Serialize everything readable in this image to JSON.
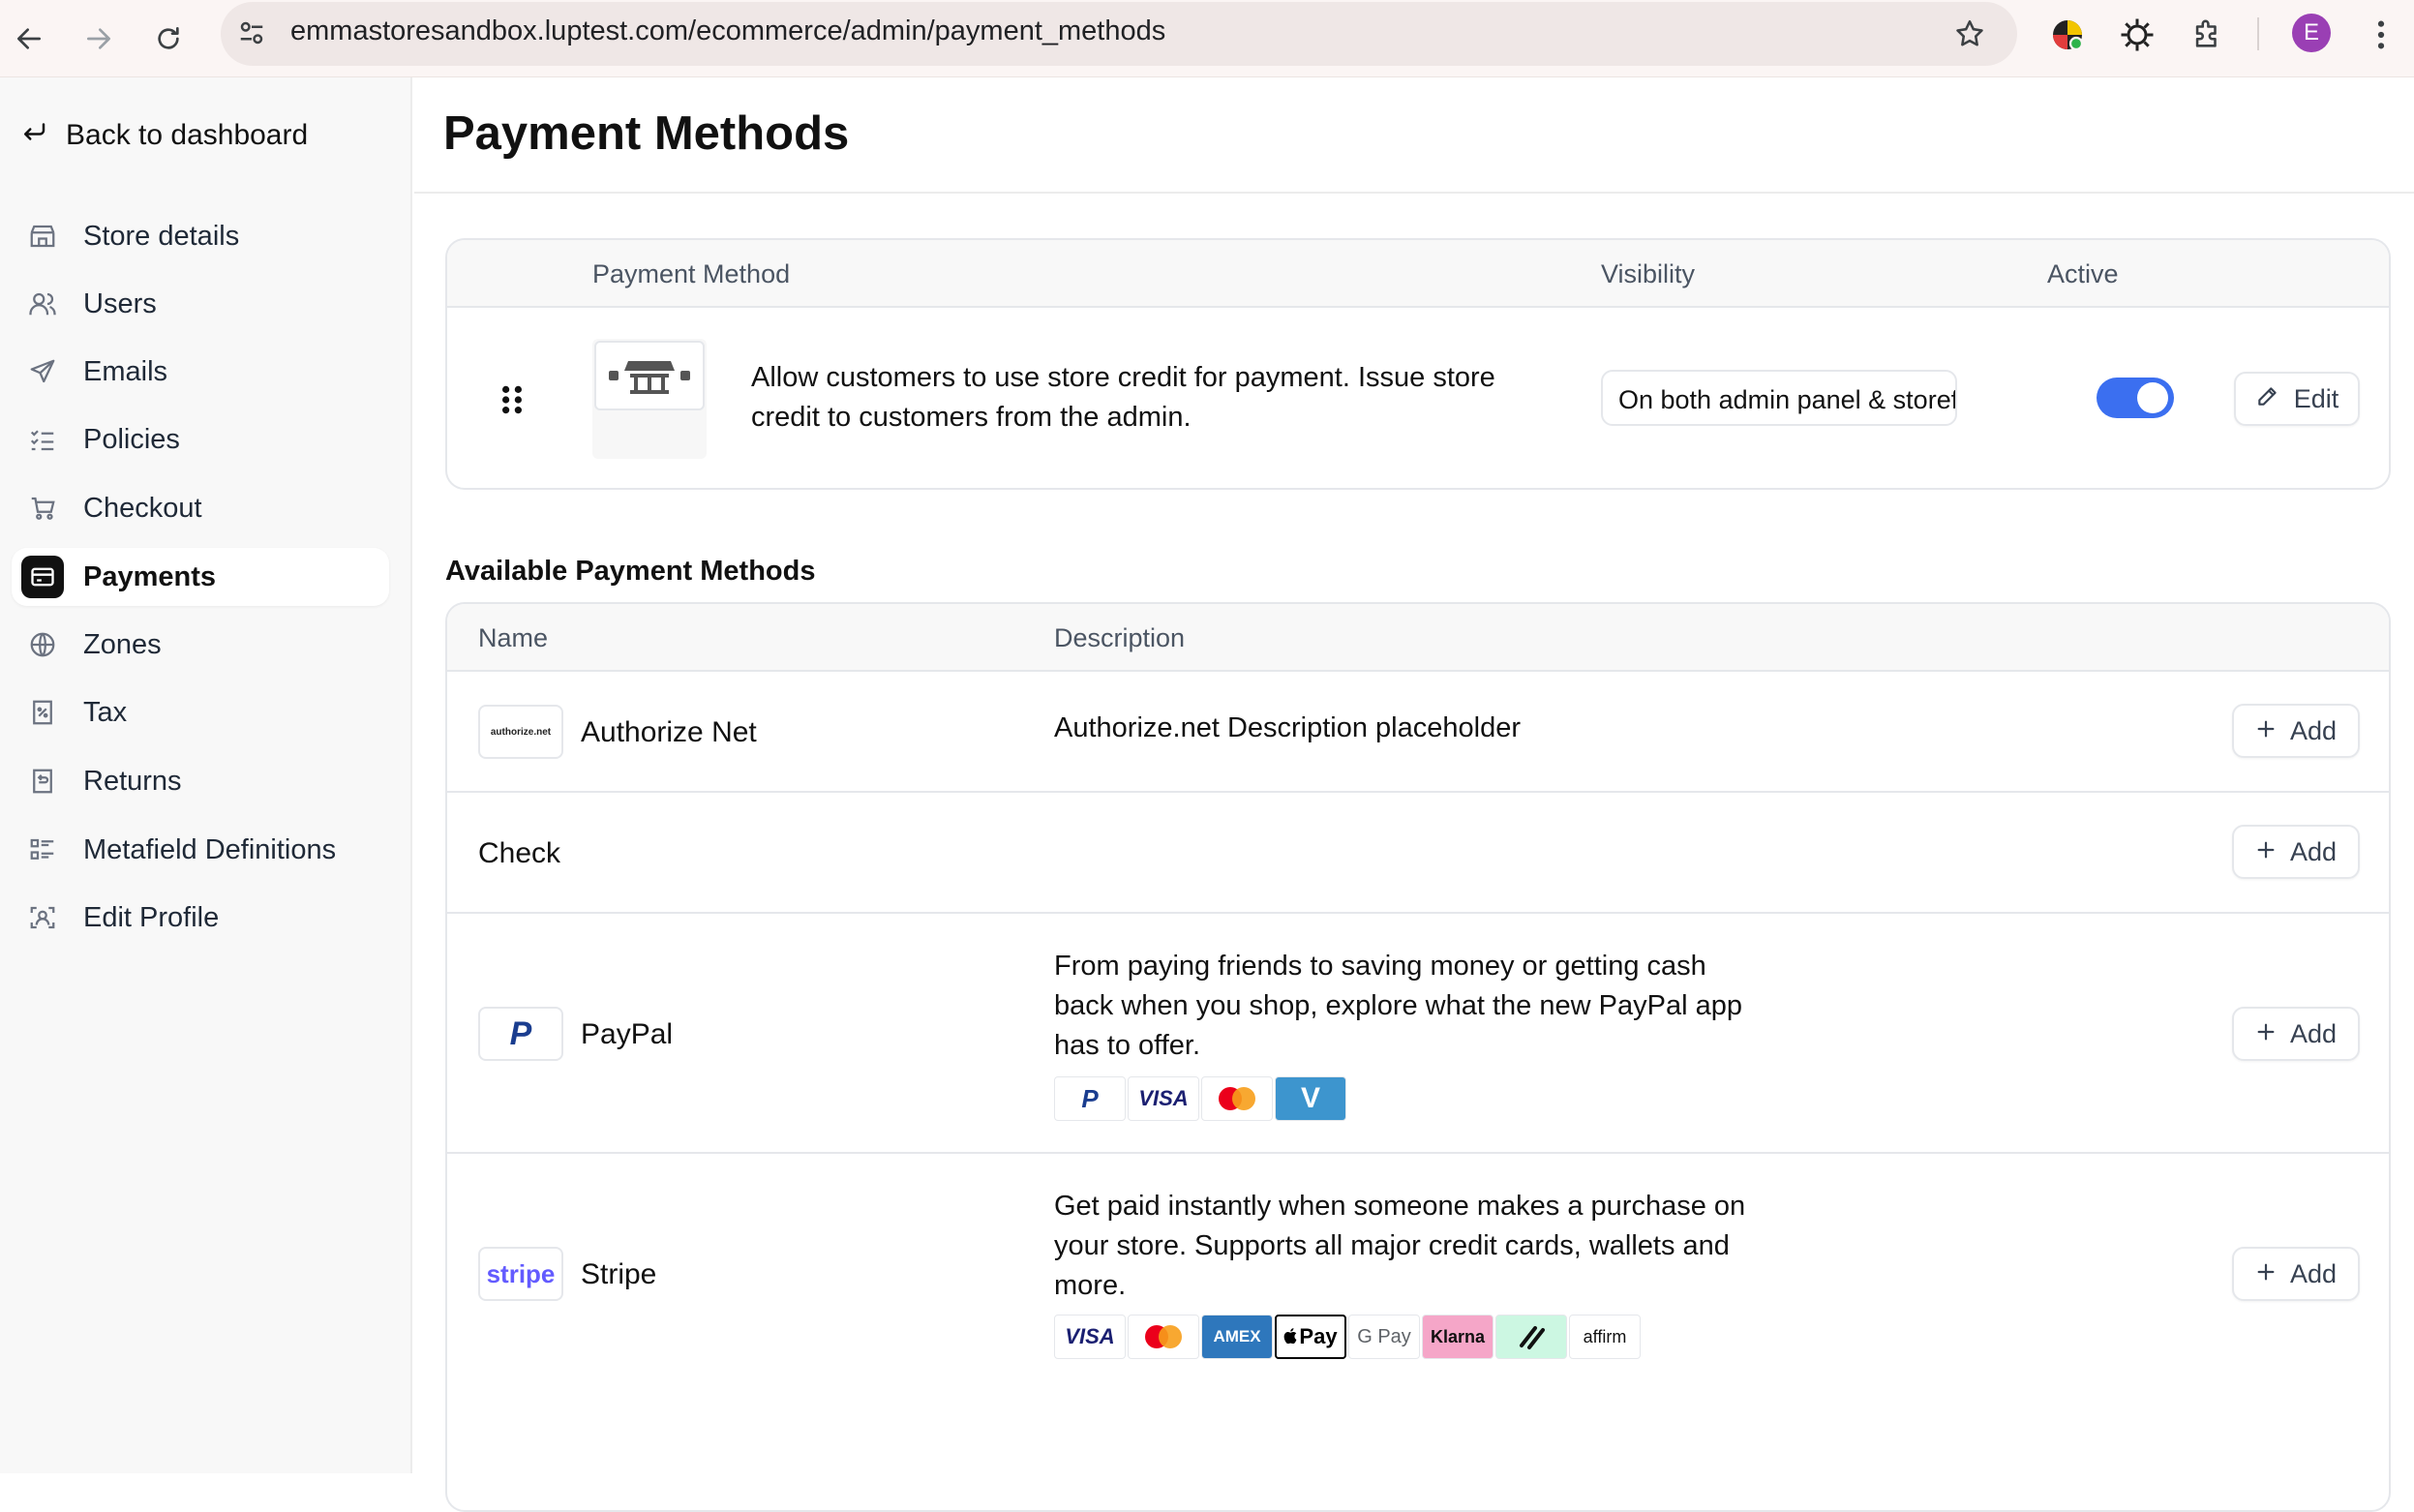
{
  "browser": {
    "url": "emmastoresandbox.luptest.com/ecommerce/admin/payment_methods",
    "profile_initial": "E"
  },
  "sidebar": {
    "back_label": "Back to dashboard",
    "items": [
      {
        "label": "Store details",
        "icon": "store-icon"
      },
      {
        "label": "Users",
        "icon": "users-icon"
      },
      {
        "label": "Emails",
        "icon": "send-icon"
      },
      {
        "label": "Policies",
        "icon": "list-check-icon"
      },
      {
        "label": "Checkout",
        "icon": "cart-icon"
      },
      {
        "label": "Payments",
        "icon": "credit-card-icon",
        "active": true
      },
      {
        "label": "Zones",
        "icon": "globe-icon"
      },
      {
        "label": "Tax",
        "icon": "percent-receipt-icon"
      },
      {
        "label": "Returns",
        "icon": "return-receipt-icon"
      },
      {
        "label": "Metafield Definitions",
        "icon": "list-detail-icon"
      },
      {
        "label": "Edit Profile",
        "icon": "face-scan-icon"
      }
    ]
  },
  "main": {
    "title": "Payment Methods",
    "active_table": {
      "headers": {
        "method": "Payment Method",
        "visibility": "Visibility",
        "active": "Active"
      },
      "row": {
        "description": "Allow customers to use store credit for payment. Issue store credit to customers from the admin.",
        "visibility": "On both admin panel & storefront",
        "active": true,
        "edit_label": "Edit"
      }
    },
    "available": {
      "heading": "Available Payment Methods",
      "headers": {
        "name": "Name",
        "description": "Description"
      },
      "add_label": "Add",
      "rows": [
        {
          "name": "Authorize Net",
          "logo": "authorize.net",
          "description": "Authorize.net Description placeholder"
        },
        {
          "name": "Check",
          "description": ""
        },
        {
          "name": "PayPal",
          "logo": "P",
          "description": "From paying friends to saving money or getting cash back when you shop, explore what the new PayPal app has to offer.",
          "badges": [
            "P",
            "VISA",
            "mastercard",
            "V"
          ]
        },
        {
          "name": "Stripe",
          "logo": "stripe",
          "description": "Get paid instantly when someone makes a purchase on your store. Supports all major credit cards, wallets and more.",
          "badges": [
            "VISA",
            "mastercard",
            "AMEX",
            "Pay",
            "G Pay",
            "Klarna",
            "link",
            "affirm"
          ]
        }
      ]
    }
  }
}
